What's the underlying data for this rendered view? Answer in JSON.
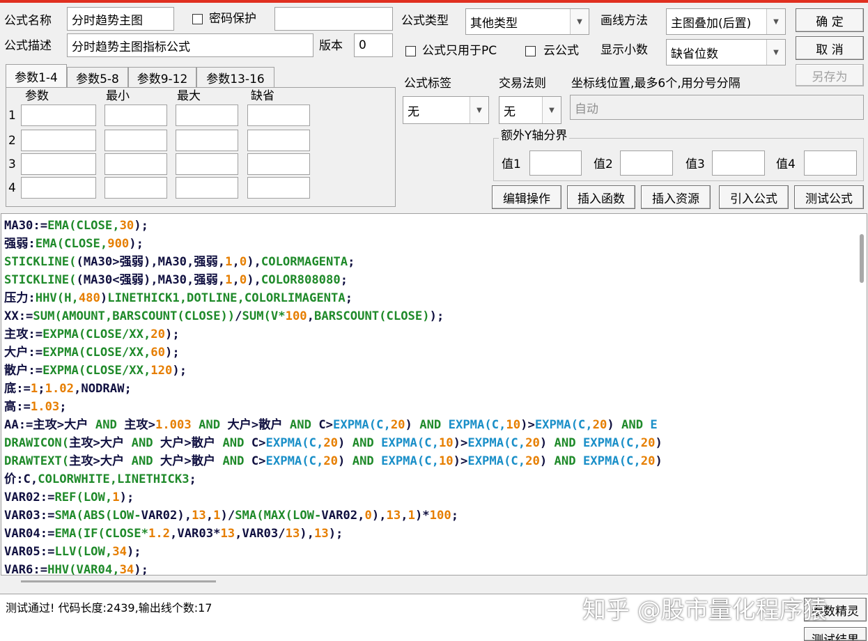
{
  "form": {
    "name_label": "公式名称",
    "name_value": "分时趋势主图",
    "password_label": "密码保护",
    "password_value": "",
    "desc_label": "公式描述",
    "desc_value": "分时趋势主图指标公式",
    "version_label": "版本",
    "version_value": "0",
    "type_label": "公式类型",
    "type_value": "其他类型",
    "draw_label": "画线方法",
    "draw_value": "主图叠加(后置)",
    "pc_only_label": "公式只用于PC",
    "cloud_label": "云公式",
    "decimal_label": "显示小数",
    "decimal_value": "缺省位数",
    "tag_label": "公式标签",
    "tag_value": "无",
    "rule_label": "交易法则",
    "rule_value": "无",
    "coord_label": "坐标线位置,最多6个,用分号分隔",
    "coord_placeholder": "自动",
    "yaxis_group": "额外Y轴分界",
    "y_labels": [
      "值1",
      "值2",
      "值3",
      "值4"
    ]
  },
  "buttons": {
    "ok": "确  定",
    "cancel": "取  消",
    "save_as": "另存为",
    "edit": "编辑操作",
    "insert_func": "插入函数",
    "insert_res": "插入资源",
    "import": "引入公式",
    "test": "测试公式",
    "hidden_1": "参数精灵",
    "hidden_2": "测试结果"
  },
  "params": {
    "tabs": [
      "参数1-4",
      "参数5-8",
      "参数9-12",
      "参数13-16"
    ],
    "headers": [
      "参数",
      "最小",
      "最大",
      "缺省"
    ],
    "rows": [
      "1",
      "2",
      "3",
      "4"
    ]
  },
  "code_lines": [
    [
      [
        "MA30:=",
        "v"
      ],
      [
        "EMA(CLOSE,",
        "f"
      ],
      [
        "30",
        "n"
      ],
      [
        ");",
        "v"
      ]
    ],
    [
      [
        "强弱:",
        "v"
      ],
      [
        "EMA(CLOSE,",
        "f"
      ],
      [
        "900",
        "n"
      ],
      [
        ");",
        "v"
      ]
    ],
    [
      [
        "STICKLINE(",
        "f"
      ],
      [
        "(MA30>强弱),MA30,强弱,",
        "v"
      ],
      [
        "1",
        "n"
      ],
      [
        ",",
        "v"
      ],
      [
        "0",
        "n"
      ],
      [
        "),",
        "v"
      ],
      [
        "COLORMAGENTA",
        "f"
      ],
      [
        ";",
        "v"
      ]
    ],
    [
      [
        "STICKLINE(",
        "f"
      ],
      [
        "(MA30<强弱),MA30,强弱,",
        "v"
      ],
      [
        "1",
        "n"
      ],
      [
        ",",
        "v"
      ],
      [
        "0",
        "n"
      ],
      [
        "),",
        "v"
      ],
      [
        "COLOR808080",
        "f"
      ],
      [
        ";",
        "v"
      ]
    ],
    [
      [
        "压力:",
        "v"
      ],
      [
        "HHV(H,",
        "f"
      ],
      [
        "480",
        "n"
      ],
      [
        ")",
        "v"
      ],
      [
        "LINETHICK1,DOTLINE,COLORLIMAGENTA",
        "f"
      ],
      [
        ";",
        "v"
      ]
    ],
    [
      [
        "XX:=",
        "v"
      ],
      [
        "SUM(AMOUNT,BARSCOUNT(CLOSE))",
        "f"
      ],
      [
        "/",
        "v"
      ],
      [
        "SUM(V*",
        "f"
      ],
      [
        "100",
        "n"
      ],
      [
        ",",
        "v"
      ],
      [
        "BARSCOUNT(CLOSE)",
        "f"
      ],
      [
        ");",
        "v"
      ]
    ],
    [
      [
        "主攻:=",
        "v"
      ],
      [
        "EXPMA(CLOSE/XX,",
        "f"
      ],
      [
        "20",
        "n"
      ],
      [
        ");",
        "v"
      ]
    ],
    [
      [
        "大户:=",
        "v"
      ],
      [
        "EXPMA(CLOSE/XX,",
        "f"
      ],
      [
        "60",
        "n"
      ],
      [
        ");",
        "v"
      ]
    ],
    [
      [
        "散户:=",
        "v"
      ],
      [
        "EXPMA(CLOSE/XX,",
        "f"
      ],
      [
        "120",
        "n"
      ],
      [
        ");",
        "v"
      ]
    ],
    [
      [
        "底:=",
        "v"
      ],
      [
        "1",
        "n"
      ],
      [
        ";",
        "v"
      ],
      [
        "1.02",
        "n"
      ],
      [
        ",NODRAW;",
        "v"
      ]
    ],
    [
      [
        "高:=",
        "v"
      ],
      [
        "1.03",
        "n"
      ],
      [
        ";",
        "v"
      ]
    ],
    [
      [
        "AA:=主攻>大户 ",
        "v"
      ],
      [
        "AND",
        "f"
      ],
      [
        " 主攻>",
        "v"
      ],
      [
        "1.003",
        "n"
      ],
      [
        " ",
        "v"
      ],
      [
        "AND",
        "f"
      ],
      [
        " 大户>散户 ",
        "v"
      ],
      [
        "AND",
        "f"
      ],
      [
        " C>",
        "v"
      ],
      [
        "EXPMA(C,",
        "b"
      ],
      [
        "20",
        "n"
      ],
      [
        ") ",
        "v"
      ],
      [
        "AND",
        "f"
      ],
      [
        " ",
        "v"
      ],
      [
        "EXPMA(C,",
        "b"
      ],
      [
        "10",
        "n"
      ],
      [
        ")>",
        "v"
      ],
      [
        "EXPMA(C,",
        "b"
      ],
      [
        "20",
        "n"
      ],
      [
        ") ",
        "v"
      ],
      [
        "AND",
        "f"
      ],
      [
        " E",
        "b"
      ]
    ],
    [
      [
        "DRAWICON(",
        "f"
      ],
      [
        "主攻>大户 ",
        "v"
      ],
      [
        "AND",
        "f"
      ],
      [
        " 大户>散户 ",
        "v"
      ],
      [
        "AND",
        "f"
      ],
      [
        " C>",
        "v"
      ],
      [
        "EXPMA(C,",
        "b"
      ],
      [
        "20",
        "n"
      ],
      [
        ") ",
        "v"
      ],
      [
        "AND",
        "f"
      ],
      [
        " ",
        "v"
      ],
      [
        "EXPMA(C,",
        "b"
      ],
      [
        "10",
        "n"
      ],
      [
        ")>",
        "v"
      ],
      [
        "EXPMA(C,",
        "b"
      ],
      [
        "20",
        "n"
      ],
      [
        ") ",
        "v"
      ],
      [
        "AND",
        "f"
      ],
      [
        " ",
        "v"
      ],
      [
        "EXPMA(C,",
        "b"
      ],
      [
        "20",
        "n"
      ],
      [
        ")",
        "v"
      ]
    ],
    [
      [
        "DRAWTEXT(",
        "f"
      ],
      [
        "主攻>大户 ",
        "v"
      ],
      [
        "AND",
        "f"
      ],
      [
        " 大户>散户 ",
        "v"
      ],
      [
        "AND",
        "f"
      ],
      [
        " C>",
        "v"
      ],
      [
        "EXPMA(C,",
        "b"
      ],
      [
        "20",
        "n"
      ],
      [
        ") ",
        "v"
      ],
      [
        "AND",
        "f"
      ],
      [
        " ",
        "v"
      ],
      [
        "EXPMA(C,",
        "b"
      ],
      [
        "10",
        "n"
      ],
      [
        ")>",
        "v"
      ],
      [
        "EXPMA(C,",
        "b"
      ],
      [
        "20",
        "n"
      ],
      [
        ") ",
        "v"
      ],
      [
        "AND",
        "f"
      ],
      [
        " ",
        "v"
      ],
      [
        "EXPMA(C,",
        "b"
      ],
      [
        "20",
        "n"
      ],
      [
        ")",
        "v"
      ]
    ],
    [
      [
        "价:C,",
        "v"
      ],
      [
        "COLORWHITE,LINETHICK3",
        "f"
      ],
      [
        ";",
        "v"
      ]
    ],
    [
      [
        "VAR02:=",
        "v"
      ],
      [
        "REF(LOW,",
        "f"
      ],
      [
        "1",
        "n"
      ],
      [
        ");",
        "v"
      ]
    ],
    [
      [
        "VAR03:=",
        "v"
      ],
      [
        "SMA(ABS(LOW-",
        "f"
      ],
      [
        "VAR02),",
        "v"
      ],
      [
        "13",
        "n"
      ],
      [
        ",",
        "v"
      ],
      [
        "1",
        "n"
      ],
      [
        ")/",
        "v"
      ],
      [
        "SMA(MAX(LOW-",
        "f"
      ],
      [
        "VAR02,",
        "v"
      ],
      [
        "0",
        "n"
      ],
      [
        "),",
        "v"
      ],
      [
        "13",
        "n"
      ],
      [
        ",",
        "v"
      ],
      [
        "1",
        "n"
      ],
      [
        ")*",
        "v"
      ],
      [
        "100",
        "n"
      ],
      [
        ";",
        "v"
      ]
    ],
    [
      [
        "VAR04:=",
        "v"
      ],
      [
        "EMA(IF(CLOSE*",
        "f"
      ],
      [
        "1.2",
        "n"
      ],
      [
        ",VAR03*",
        "v"
      ],
      [
        "13",
        "n"
      ],
      [
        ",VAR03/",
        "v"
      ],
      [
        "13",
        "n"
      ],
      [
        "),",
        "v"
      ],
      [
        "13",
        "n"
      ],
      [
        ");",
        "v"
      ]
    ],
    [
      [
        "VAR05:=",
        "v"
      ],
      [
        "LLV(LOW,",
        "f"
      ],
      [
        "34",
        "n"
      ],
      [
        ");",
        "v"
      ]
    ],
    [
      [
        "VAR6:=",
        "v"
      ],
      [
        "HHV(VAR04,",
        "f"
      ],
      [
        "34",
        "n"
      ],
      [
        ");",
        "v"
      ]
    ]
  ],
  "status": {
    "message": "测试通过! 代码长度:2439,输出线个数:17"
  },
  "watermark": "知乎 @股市量化程序猿"
}
